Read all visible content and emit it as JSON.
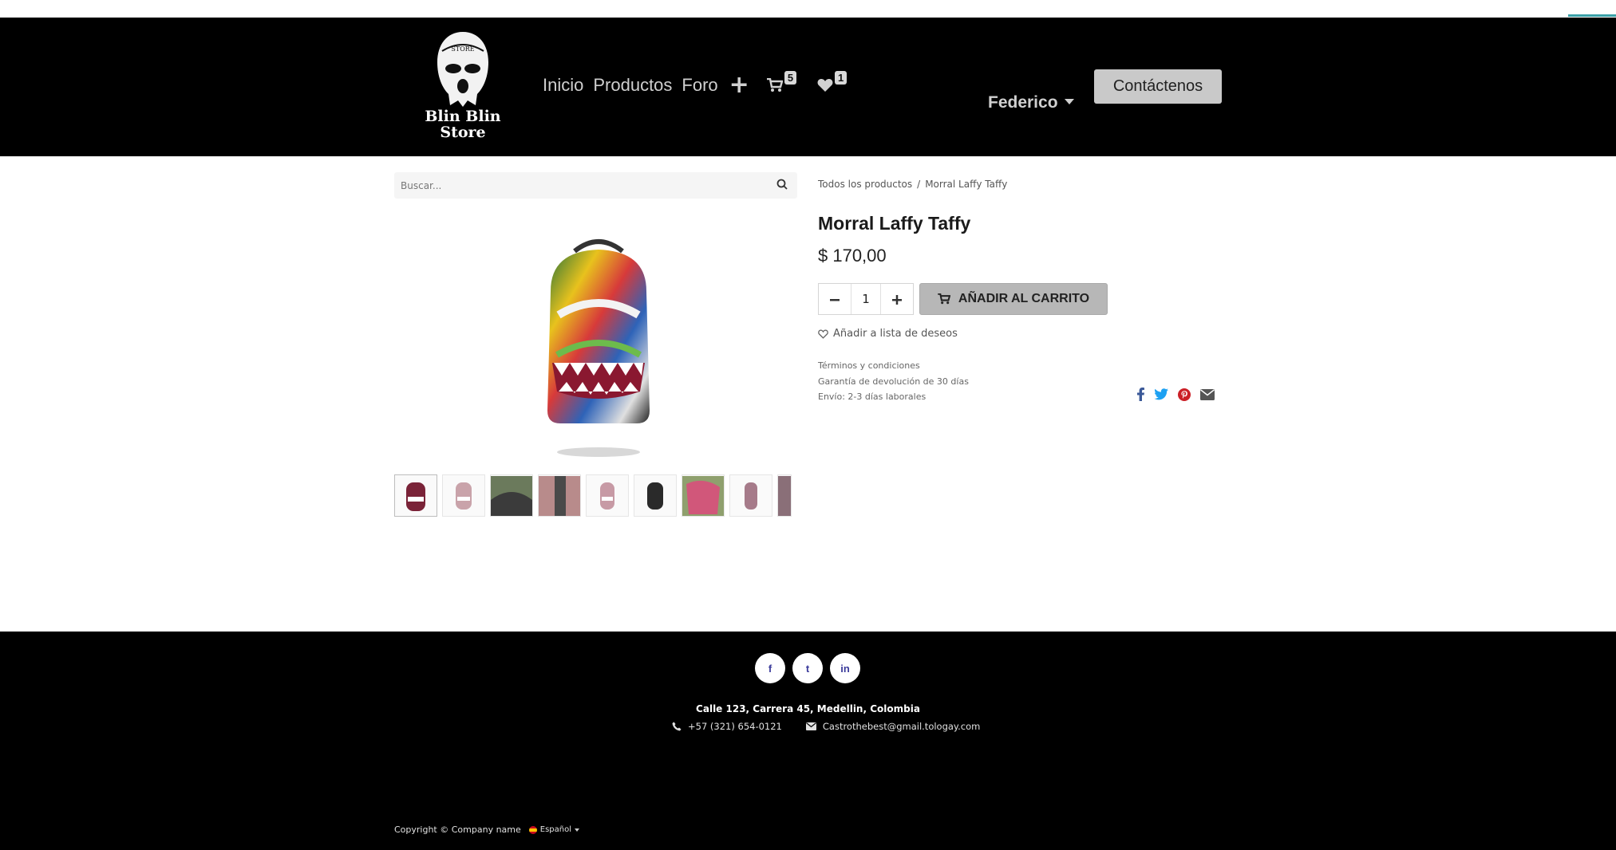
{
  "logo": {
    "text_line1": "Blin Blin",
    "text_line2": "Store",
    "hat_text": "STORE"
  },
  "nav": {
    "items": [
      {
        "label": "Inicio"
      },
      {
        "label": "Productos"
      },
      {
        "label": "Foro"
      }
    ],
    "plus_label": "+",
    "cart_count": "5",
    "wishlist_count": "1",
    "user_name": "Federico",
    "contact_label": "Contáctenos"
  },
  "search": {
    "placeholder": "Buscar..."
  },
  "breadcrumb": {
    "parent": "Todos los productos",
    "separator": "/",
    "current": "Morral Laffy Taffy"
  },
  "product": {
    "title": "Morral Laffy Taffy",
    "price": "$ 170,00",
    "quantity": "1",
    "add_to_cart_label": "AÑADIR AL CARRITO",
    "wishlist_label": "Añadir a lista de deseos",
    "terms": [
      "Términos y condiciones",
      "Garantía de devolución de 30 días",
      "Envío: 2-3 días laborales"
    ]
  },
  "footer": {
    "social": [
      "f",
      "t",
      "in"
    ],
    "address": "Calle 123, Carrera 45, Medellin, Colombia",
    "phone": "+57 (321) 654-0121",
    "email": "Castrothebest@gmail.tologay.com",
    "copyright": "Copyright © Company name",
    "language": "Español"
  },
  "colors": {
    "header_bg": "#000000",
    "footer_bg": "#000000",
    "contact_button": "#c9c9c9",
    "add_to_cart_button": "#b7b7b7",
    "facebook": "#3b5998",
    "twitter": "#1da1f2",
    "pinterest": "#cb2027",
    "email": "#555555"
  }
}
